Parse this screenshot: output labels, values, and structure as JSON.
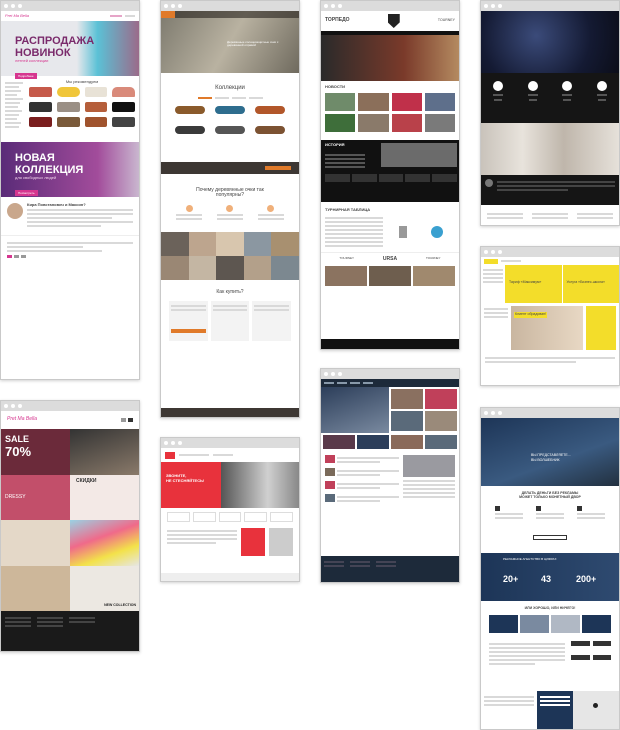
{
  "w1": {
    "logo": "Pret Ma Bella",
    "hero_title_line1": "РАСПРОДАЖА",
    "hero_title_line2": "НОВИНОК",
    "hero_sub": "летней коллекции",
    "hero_btn": "Подробнее",
    "section_title": "Мы рекомендуем",
    "promo_title_line1": "НОВАЯ",
    "promo_title_line2": "КОЛЛЕКЦИЯ",
    "promo_sub": "для свободных людей",
    "promo_btn": "Посмотреть",
    "about_title": "Кира Повстанович и Максин?"
  },
  "w2": {
    "hero_text": "Деревянные солнцезащитные очки с деревянной оправой",
    "collections_title": "Коллекции",
    "why_title": "Почему деревянные очки так популярны?",
    "buy_title": "Как купить?"
  },
  "w3": {
    "logo": "ТОРПЕДО",
    "partner": "TOURNEY",
    "news_title": "НОВОСТИ",
    "history_title": "ИСТОРИЯ",
    "tournament_title": "ТУРНИРНАЯ ТАБЛИЦА",
    "brand2": "URSA"
  },
  "w4": {},
  "w5": {
    "logo": "Pret Ma Bella",
    "sale": "SALE",
    "sale_pct": "70%",
    "discount": "СКИДКИ",
    "promo_word": "DRESSY",
    "new_coll": "NEW COLLECTION"
  },
  "w6": {
    "hero_line1": "ЗВОНИТЕ,",
    "hero_line2": "НЕ СТЕСНЯЙТЕСЬ!"
  },
  "w7": {},
  "w8": {
    "card1_title": "Тариф «Максимум»",
    "card2_title": "Услуга «Бизнес-школа»",
    "card3_title": "Клиент обрадован!"
  },
  "w9": {
    "hero_line1": "ВЫ ПРЕДСТАВЛЯЕТЕ...",
    "hero_line2": "ВЫ ВОЛШЕБНИК",
    "money_title": "ДЕЛАТЬ ДЕНЬГИ БЕЗ РЕКЛАМЫ",
    "money_sub": "МОЖЕТ ТОЛЬКО МОНЕТНЫЙ ДВОР",
    "numbers_title": "РЕКЛАМНОЕ АГЕНТСТВО В ЦИФРАХ",
    "n1": "20+",
    "n2": "43",
    "n3": "200+",
    "question": "ИЛИ ХОРОШО, ИЛИ НИЧЕГО!"
  },
  "colors": {
    "pink": "#d6368f",
    "purple": "#6b3e8f",
    "orange": "#e07a2a",
    "red": "#e8323c",
    "yellow": "#f3dd2a",
    "navy": "#1d3557"
  }
}
